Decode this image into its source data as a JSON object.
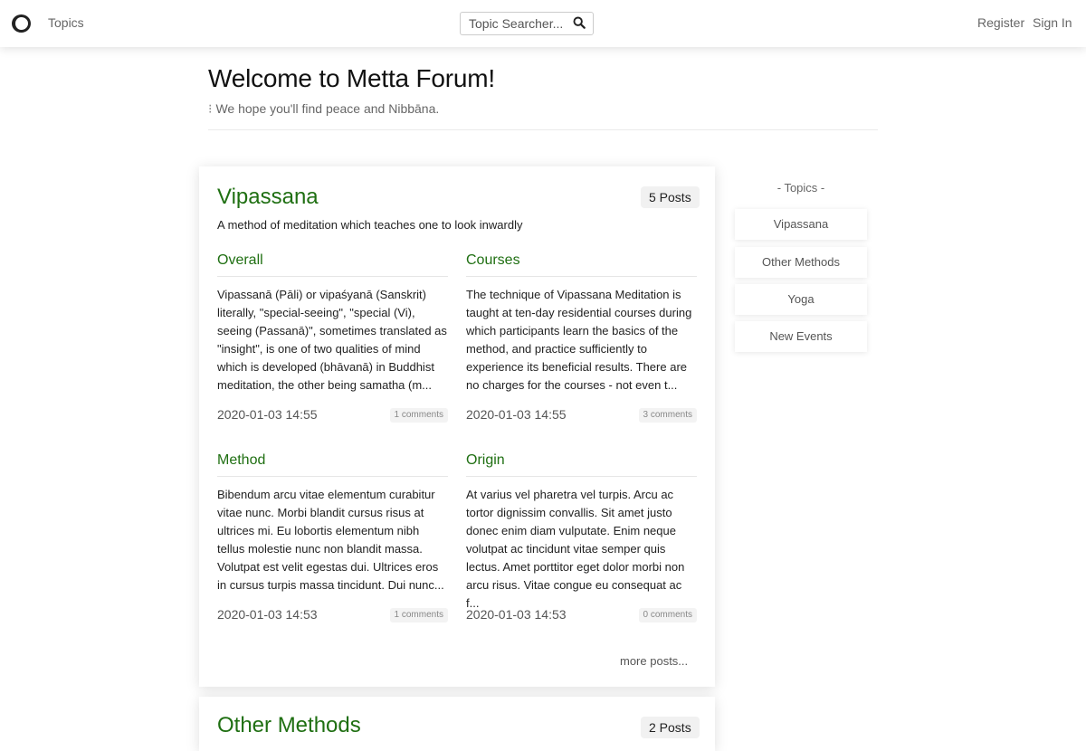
{
  "navbar": {
    "logo_icon": "ring-logo-icon",
    "topics_link": "Topics",
    "search_placeholder": "Topic Searcher...",
    "search_icon": "search-icon",
    "register": "Register",
    "sign_in": "Sign In"
  },
  "header": {
    "title": "Welcome to Metta Forum!",
    "subtitle_marker": "⁝",
    "subtitle": "We hope you'll find peace and Nibbāna."
  },
  "topics": [
    {
      "title": "Vipassana",
      "posts_count": "5 Posts",
      "description": "A method of meditation which teaches one to look inwardly",
      "posts": [
        {
          "title": "Overall",
          "excerpt": "Vipassanā (Pāli) or vipaśyanā (Sanskrit) literally, \"special-seeing\", \"special (Vi), seeing (Passanā)\", sometimes translated as \"insight\", is one of two qualities of mind which is developed (bhāvanā) in Buddhist meditation, the other being samatha (m...",
          "date": "2020-01-03 14:55",
          "comments": "1 comments"
        },
        {
          "title": "Courses",
          "excerpt": "The technique of Vipassana Meditation is taught at ten-day residential courses during which participants learn the basics of the method, and practice sufficiently to experience its beneficial results. There are no charges for the courses - not even t...",
          "date": "2020-01-03 14:55",
          "comments": "3 comments"
        },
        {
          "title": "Method",
          "excerpt": "Bibendum arcu vitae elementum curabitur vitae nunc. Morbi blandit cursus risus at ultrices mi. Eu lobortis elementum nibh tellus molestie nunc non blandit massa. Volutpat est velit egestas dui. Ultrices eros in cursus turpis massa tincidunt. Dui nunc...",
          "date": "2020-01-03 14:53",
          "comments": "1 comments"
        },
        {
          "title": "Origin",
          "excerpt": "At varius vel pharetra vel turpis. Arcu ac tortor dignissim convallis. Sit amet justo donec enim diam vulputate. Enim neque volutpat ac tincidunt vitae semper quis lectus. Amet porttitor eget dolor morbi non arcu risus. Vitae congue eu consequat ac f...",
          "date": "2020-01-03 14:53",
          "comments": "0 comments"
        }
      ],
      "more_posts": "more posts..."
    },
    {
      "title": "Other Methods",
      "posts_count": "2 Posts"
    }
  ],
  "sidebar": {
    "title": "- Topics -",
    "items": [
      "Vipassana",
      "Other Methods",
      "Yoga",
      "New Events"
    ]
  },
  "colors": {
    "accent_green": "#1f6f12",
    "text": "#222222",
    "muted": "#666666"
  }
}
